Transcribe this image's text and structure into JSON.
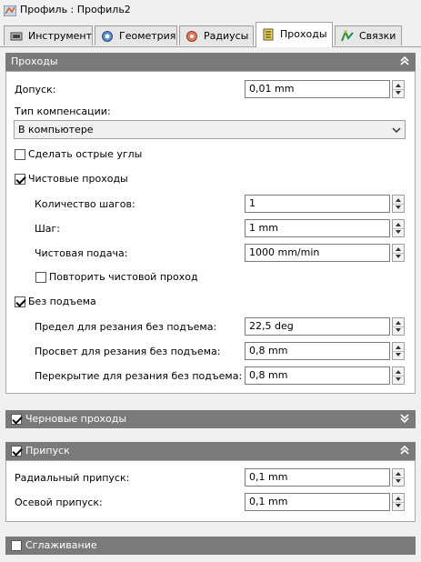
{
  "window": {
    "title": "Профиль : Профиль2"
  },
  "tabs": [
    {
      "label": "Инструмент",
      "icon": "tool-icon"
    },
    {
      "label": "Геометрия",
      "icon": "geometry-icon"
    },
    {
      "label": "Радиусы",
      "icon": "radii-icon"
    },
    {
      "label": "Проходы",
      "icon": "passes-icon",
      "active": true
    },
    {
      "label": "Связки",
      "icon": "linking-icon"
    }
  ],
  "passes": {
    "header": "Проходы",
    "tolerance_label": "Допуск:",
    "tolerance_value": "0,01 mm",
    "compensation_label": "Тип компенсации:",
    "compensation_value": "В компьютере",
    "sharp_corners_label": "Сделать острые углы",
    "sharp_corners_checked": false,
    "finishing_label": "Чистовые проходы",
    "finishing_checked": true,
    "steps_label": "Количество шагов:",
    "steps_value": "1",
    "step_label": "Шаг:",
    "step_value": "1 mm",
    "feed_label": "Чистовая подача:",
    "feed_value": "1000 mm/min",
    "repeat_label": "Повторить чистовой проход",
    "repeat_checked": false,
    "no_lift_label": "Без подъема",
    "no_lift_checked": true,
    "limit_label": "Предел для резания без подъема:",
    "limit_value": "22,5 deg",
    "clearance_label": "Просвет для резания без подъема:",
    "clearance_value": "0,8 mm",
    "overlap_label": "Перекрытие для резания без подъема:",
    "overlap_value": "0,8 mm"
  },
  "roughing": {
    "header": "Черновые проходы",
    "checked": true
  },
  "stock": {
    "header": "Припуск",
    "checked": true,
    "radial_label": "Радиальный припуск:",
    "radial_value": "0,1 mm",
    "axial_label": "Осевой припуск:",
    "axial_value": "0,1 mm"
  },
  "smoothing": {
    "header": "Сглаживание",
    "checked": false
  },
  "colors": {
    "section_header_bg": "#7a7a7a",
    "panel_bg": "#ffffff",
    "window_bg": "#f0f0f0"
  }
}
